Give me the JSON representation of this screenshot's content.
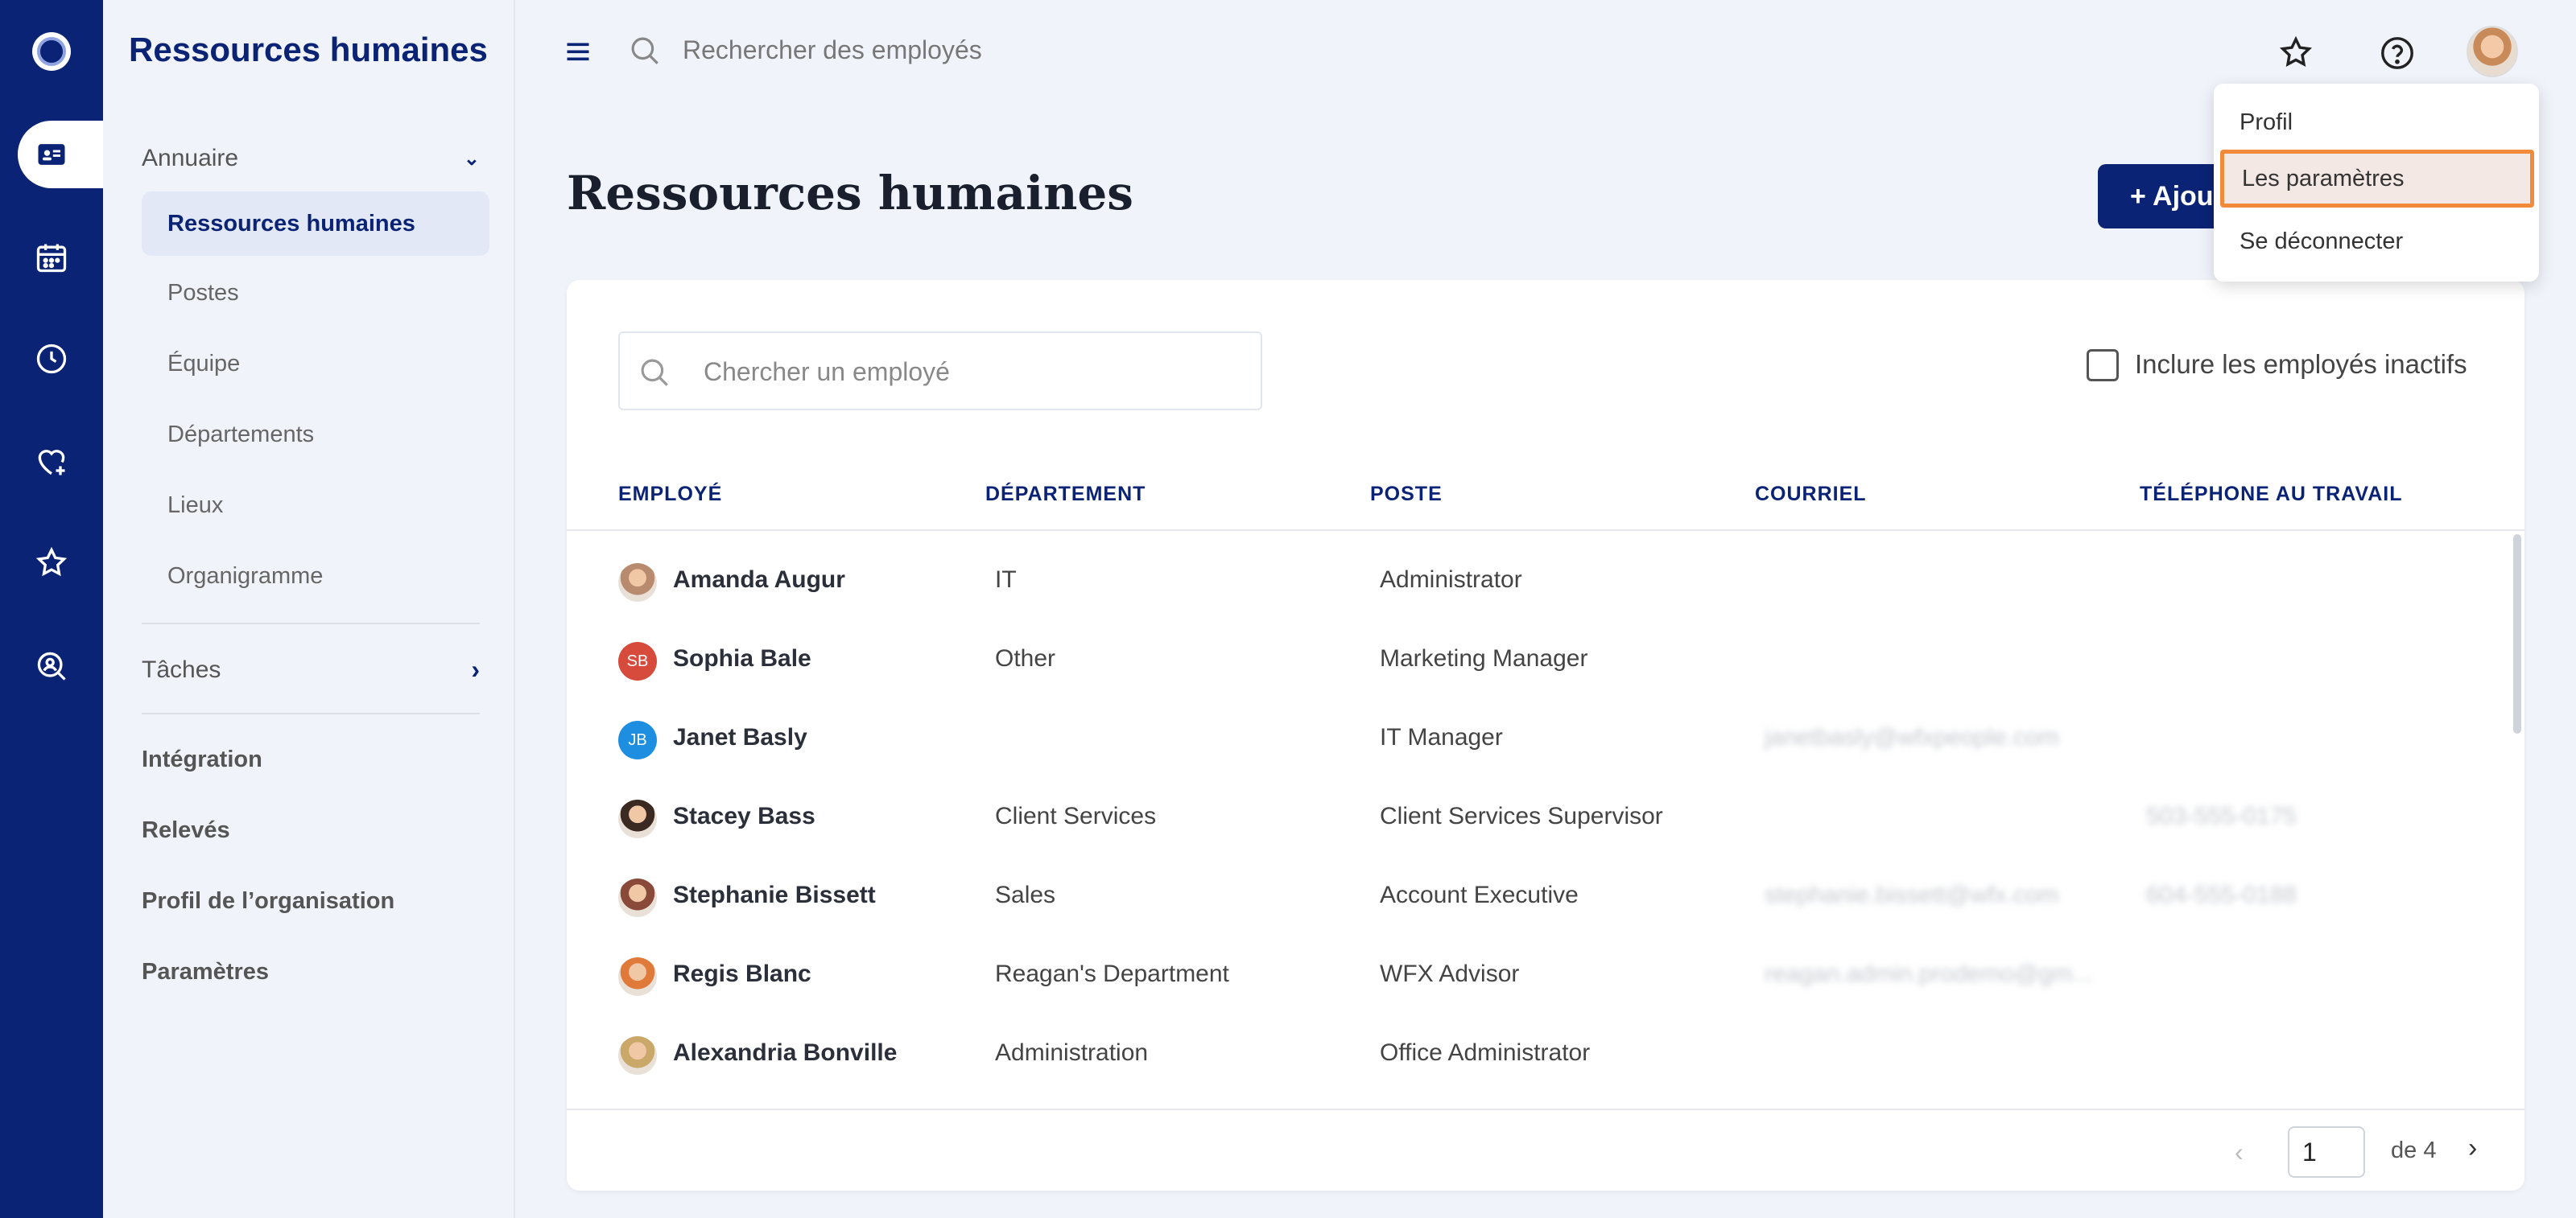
{
  "app": {
    "title": "Ressources humaines"
  },
  "sidebar": {
    "group_directory": "Annuaire",
    "directory_items": [
      {
        "label": "Ressources humaines",
        "active": true
      },
      {
        "label": "Postes"
      },
      {
        "label": "Équipe"
      },
      {
        "label": "Départements"
      },
      {
        "label": "Lieux"
      },
      {
        "label": "Organigramme"
      }
    ],
    "group_tasks": "Tâches",
    "bottom_items": [
      "Intégration",
      "Relevés",
      "Profil de l’organisation",
      "Paramètres"
    ]
  },
  "topbar": {
    "search_placeholder": "Rechercher des employés"
  },
  "page": {
    "title": "Ressources humaines",
    "add_button": "+ Ajou"
  },
  "filters": {
    "search_placeholder": "Chercher un employé",
    "include_inactive": "Inclure les employés inactifs"
  },
  "table": {
    "headers": [
      "EMPLOYÉ",
      "DÉPARTEMENT",
      "POSTE",
      "COURRIEL",
      "TÉLÉPHONE AU TRAVAIL"
    ],
    "rows": [
      {
        "name": "Amanda Augur",
        "dept": "IT",
        "position": "Administrator",
        "email": "",
        "phone": "",
        "avatar": "photo",
        "color": "#b98b6e"
      },
      {
        "name": "Sophia Bale",
        "dept": "Other",
        "position": "Marketing Manager",
        "email": "",
        "phone": "",
        "avatar": "SB",
        "color": "#d64b3b"
      },
      {
        "name": "Janet Basly",
        "dept": "",
        "position": "IT Manager",
        "email": "janetbasly@wfxpeople.com",
        "phone": "",
        "avatar": "JB",
        "color": "#1e8fe0"
      },
      {
        "name": "Stacey Bass",
        "dept": "Client Services",
        "position": "Client Services Supervisor",
        "email": "",
        "phone": "503-555-0175",
        "avatar": "photo",
        "color": "#3a2a22"
      },
      {
        "name": "Stephanie Bissett",
        "dept": "Sales",
        "position": "Account Executive",
        "email": "stephanie.bissett@wfx.com",
        "phone": "604-555-0188",
        "avatar": "photo",
        "color": "#8a4a3a"
      },
      {
        "name": "Regis Blanc",
        "dept": "Reagan's Department",
        "position": "WFX Advisor",
        "email": "reagan.admin.prodemo@gm...",
        "phone": "",
        "avatar": "photo",
        "color": "#e07a3a"
      },
      {
        "name": "Alexandria Bonville",
        "dept": "Administration",
        "position": "Office Administrator",
        "email": "",
        "phone": "",
        "avatar": "photo",
        "color": "#c9a86a"
      }
    ]
  },
  "pagination": {
    "current": "1",
    "of_label": "de 4"
  },
  "user_menu": {
    "items": [
      "Profil",
      "Les paramètres",
      "Se déconnecter"
    ],
    "highlighted": "Les paramètres"
  },
  "colors": {
    "navy": "#0b2375",
    "highlight_border": "#f28a3c"
  }
}
